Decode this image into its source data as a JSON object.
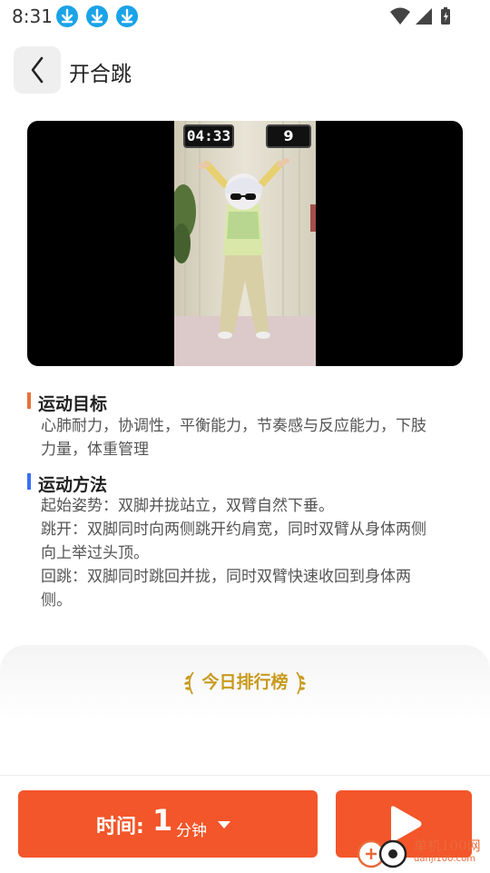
{
  "status_bar": {
    "time": "8:31"
  },
  "header": {
    "title": "开合跳"
  },
  "video": {
    "timer": "04:33",
    "count": "9"
  },
  "goal": {
    "title": "运动目标",
    "accent": "#e8723a",
    "lines": [
      "心肺耐力，协调性，平衡能力，节奏感与反应能力，下肢",
      "力量，体重管理"
    ]
  },
  "method": {
    "title": "运动方法",
    "accent": "#3b6ff5",
    "lines": [
      "起始姿势：双脚并拢站立，双臂自然下垂。",
      "跳开：双脚同时向两侧跳开约肩宽，同时双臂从身体两侧",
      "向上举过头顶。",
      "回跳：双脚同时跳回并拢，同时双臂快速收回到身体两",
      "侧。"
    ]
  },
  "ranking": {
    "title": "今日排行榜",
    "color": "#c89a1e"
  },
  "bottom": {
    "time_label": "时间:",
    "time_value": "1",
    "time_unit": "分钟",
    "button_color": "#f3562a"
  },
  "watermark": {
    "name": "单机100网",
    "url": "danji100.com"
  }
}
